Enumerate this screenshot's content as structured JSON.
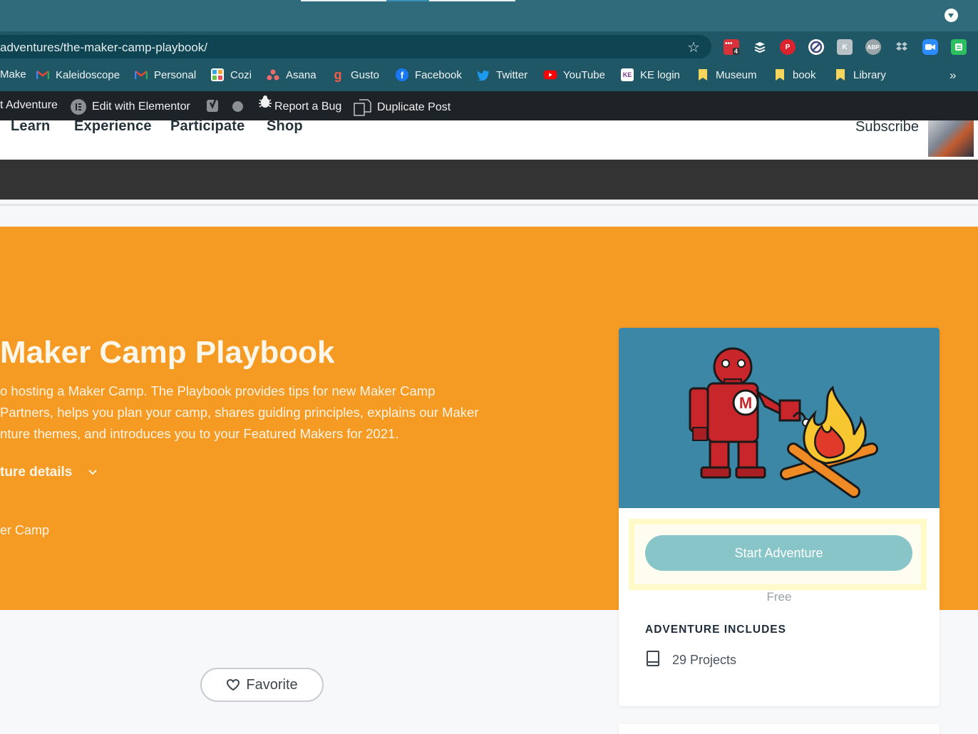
{
  "browser": {
    "url": "adventures/the-maker-camp-playbook/",
    "extension_badge": "4",
    "extensions": [
      "todo-ext-icon",
      "buffer-icon",
      "pinterest-icon",
      "blocker-icon",
      "kaleido-ext-icon",
      "abp-icon",
      "dropbox-icon",
      "zoom-icon",
      "evernote-icon"
    ],
    "abp_label": "ABP",
    "more_bookmarks": "»"
  },
  "bookmarks": [
    {
      "label": "Make",
      "icon": "bookmark-icon"
    },
    {
      "label": "Kaleidoscope",
      "icon": "gmail-icon"
    },
    {
      "label": "Personal",
      "icon": "gmail-icon"
    },
    {
      "label": "Cozi",
      "icon": "cozi-icon"
    },
    {
      "label": "Asana",
      "icon": "asana-icon"
    },
    {
      "label": "Gusto",
      "icon": "gusto-icon"
    },
    {
      "label": "Facebook",
      "icon": "facebook-icon"
    },
    {
      "label": "Twitter",
      "icon": "twitter-icon"
    },
    {
      "label": "YouTube",
      "icon": "youtube-icon"
    },
    {
      "label": "KE login",
      "icon": "ke-icon"
    },
    {
      "label": "Museum",
      "icon": "folder-icon"
    },
    {
      "label": "book",
      "icon": "folder-icon"
    },
    {
      "label": "Library",
      "icon": "folder-icon"
    }
  ],
  "adminbar": {
    "edit_adventure": "t Adventure",
    "elementor": "Edit with Elementor",
    "report_bug": "Report a Bug",
    "duplicate": "Duplicate Post"
  },
  "nav": {
    "items": [
      "Learn",
      "Experience",
      "Participate",
      "Shop"
    ],
    "subscribe": "Subscribe"
  },
  "hero": {
    "title": "Maker Camp Playbook",
    "desc_lines": [
      "o hosting a Maker Camp. The Playbook provides tips for new Maker Camp",
      "Partners, helps you plan your camp, shares guiding principles, explains our Maker",
      "nture themes, and introduces you to your Featured Makers for 2021."
    ],
    "details_label": "ture details",
    "camp_link": "er Camp"
  },
  "card": {
    "start_label": "Start Adventure",
    "price": "Free",
    "includes_heading": "ADVENTURE INCLUDES",
    "includes_item": "29 Projects",
    "robot_letter": "M"
  },
  "favorite": {
    "label": "Favorite"
  },
  "colors": {
    "hero_orange": "#f59a23",
    "card_blue": "#3d87a6",
    "button_teal": "#87c5c9",
    "toolbar": "#1f5766"
  }
}
